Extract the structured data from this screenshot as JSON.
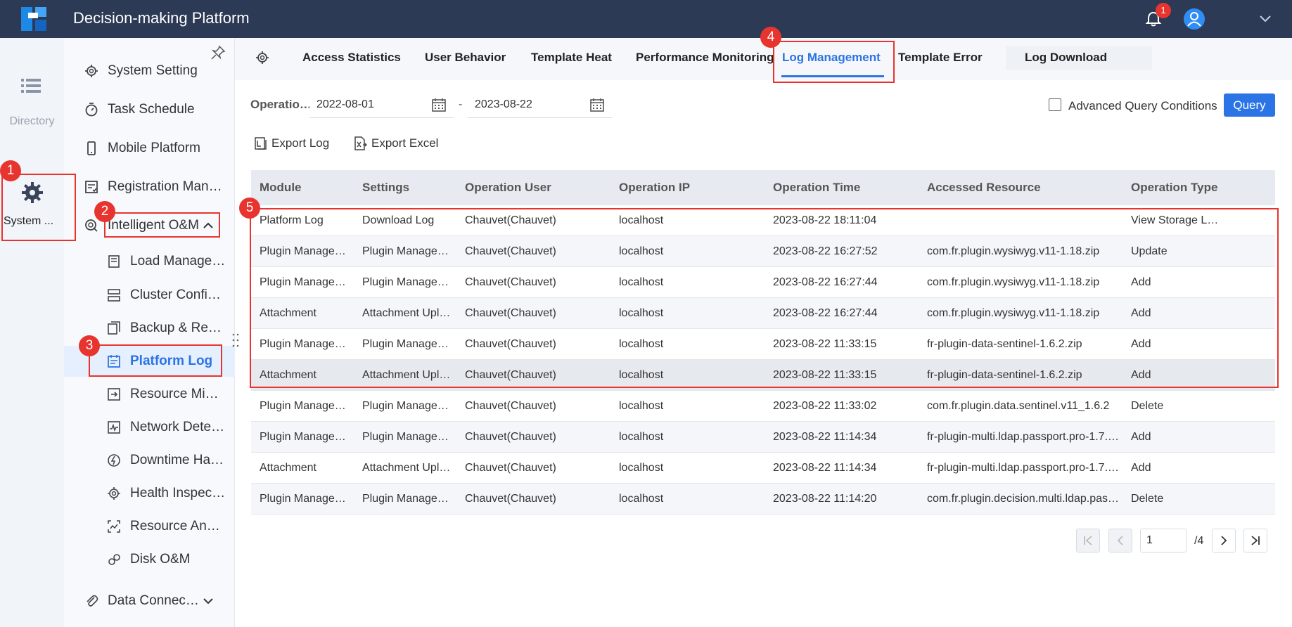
{
  "header": {
    "title": "Decision-making Platform",
    "notification_count": "1"
  },
  "rail": {
    "directory_label": "Directory",
    "system_label": "System ..."
  },
  "nav": {
    "items": [
      {
        "label": "System Setting",
        "icon": "gear-icon"
      },
      {
        "label": "Task Schedule",
        "icon": "stopwatch-icon"
      },
      {
        "label": "Mobile Platform",
        "icon": "phone-icon"
      },
      {
        "label": "Registration Man…",
        "icon": "registration-icon"
      },
      {
        "label": "Intelligent O&M",
        "icon": "om-icon"
      }
    ],
    "sub_items": [
      {
        "label": "Load Manage…",
        "icon": "load-icon"
      },
      {
        "label": "Cluster Confi…",
        "icon": "cluster-icon"
      },
      {
        "label": "Backup & Re…",
        "icon": "backup-icon"
      },
      {
        "label": "Platform Log",
        "icon": "log-icon"
      },
      {
        "label": "Resource Mi…",
        "icon": "migration-icon"
      },
      {
        "label": "Network Dete…",
        "icon": "network-icon"
      },
      {
        "label": "Downtime Ha…",
        "icon": "downtime-icon"
      },
      {
        "label": "Health Inspec…",
        "icon": "health-icon"
      },
      {
        "label": "Resource An…",
        "icon": "analysis-icon"
      },
      {
        "label": "Disk O&M",
        "icon": "disk-icon"
      }
    ],
    "data_connection_label": "Data Connec…"
  },
  "tabs": [
    "Access Statistics",
    "User Behavior",
    "Template Heat",
    "Performance Monitoring",
    "Log Management",
    "Template Error",
    "Log Download"
  ],
  "active_tab": "Log Management",
  "filter": {
    "label": "Operatio…",
    "start_date": "2022-08-01",
    "separator": "-",
    "end_date": "2023-08-22",
    "advanced_label": "Advanced Query Conditions",
    "query_label": "Query"
  },
  "actions": {
    "export_log": "Export Log",
    "export_excel": "Export Excel"
  },
  "table": {
    "headers": [
      "Module",
      "Settings",
      "Operation User",
      "Operation IP",
      "Operation Time",
      "Accessed Resource",
      "Operation Type"
    ],
    "rows": [
      [
        "Platform Log",
        "Download Log",
        "Chauvet(Chauvet)",
        "localhost",
        "2023-08-22 18:11:04",
        "",
        "View Storage L…"
      ],
      [
        "Plugin Manage…",
        "Plugin Manage…",
        "Chauvet(Chauvet)",
        "localhost",
        "2023-08-22 16:27:52",
        "com.fr.plugin.wysiwyg.v11-1.18.zip",
        "Update"
      ],
      [
        "Plugin Manage…",
        "Plugin Manage…",
        "Chauvet(Chauvet)",
        "localhost",
        "2023-08-22 16:27:44",
        "com.fr.plugin.wysiwyg.v11-1.18.zip",
        "Add"
      ],
      [
        "Attachment",
        "Attachment Upl…",
        "Chauvet(Chauvet)",
        "localhost",
        "2023-08-22 16:27:44",
        "com.fr.plugin.wysiwyg.v11-1.18.zip",
        "Add"
      ],
      [
        "Plugin Manage…",
        "Plugin Manage…",
        "Chauvet(Chauvet)",
        "localhost",
        "2023-08-22 11:33:15",
        "fr-plugin-data-sentinel-1.6.2.zip",
        "Add"
      ],
      [
        "Attachment",
        "Attachment Upl…",
        "Chauvet(Chauvet)",
        "localhost",
        "2023-08-22 11:33:15",
        "fr-plugin-data-sentinel-1.6.2.zip",
        "Add"
      ],
      [
        "Plugin Manage…",
        "Plugin Manage…",
        "Chauvet(Chauvet)",
        "localhost",
        "2023-08-22 11:33:02",
        "com.fr.plugin.data.sentinel.v11_1.6.2",
        "Delete"
      ],
      [
        "Plugin Manage…",
        "Plugin Manage…",
        "Chauvet(Chauvet)",
        "localhost",
        "2023-08-22 11:14:34",
        "fr-plugin-multi.ldap.passport.pro-1.7.…",
        "Add"
      ],
      [
        "Attachment",
        "Attachment Upl…",
        "Chauvet(Chauvet)",
        "localhost",
        "2023-08-22 11:14:34",
        "fr-plugin-multi.ldap.passport.pro-1.7.…",
        "Add"
      ],
      [
        "Plugin Manage…",
        "Plugin Manage…",
        "Chauvet(Chauvet)",
        "localhost",
        "2023-08-22 11:14:20",
        "com.fr.plugin.decision.multi.ldap.pas…",
        "Delete"
      ]
    ]
  },
  "pagination": {
    "current": "1",
    "total": "/4"
  },
  "annotations": [
    "1",
    "2",
    "3",
    "4",
    "5"
  ],
  "colors": {
    "header_bg": "#2c3a55",
    "accent": "#2b74e6",
    "annotation": "#e8342e"
  }
}
